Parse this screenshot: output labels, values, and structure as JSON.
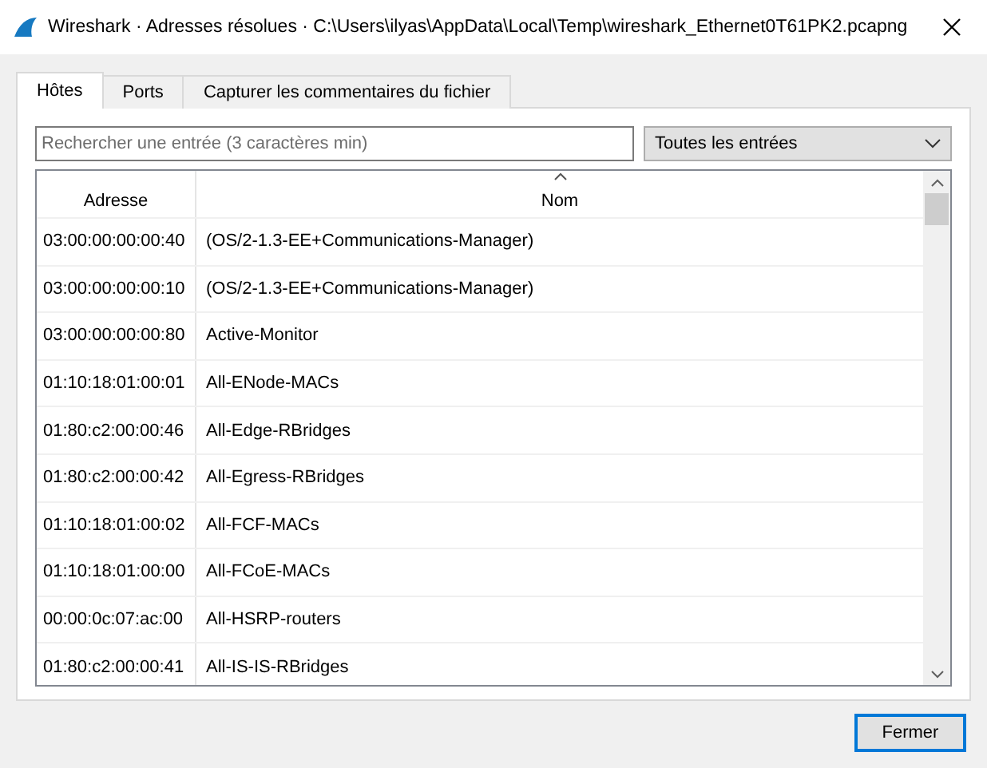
{
  "window": {
    "title": "Wireshark · Adresses résolues · C:\\Users\\ilyas\\AppData\\Local\\Temp\\wireshark_Ethernet0T61PK2.pcapng"
  },
  "tabs": [
    {
      "label": "Hôtes",
      "selected": true
    },
    {
      "label": "Ports",
      "selected": false
    },
    {
      "label": "Capturer les commentaires du fichier",
      "selected": false
    }
  ],
  "search": {
    "placeholder": "Rechercher une entrée (3 caractères min)"
  },
  "filter": {
    "value": "Toutes les entrées"
  },
  "table": {
    "columns": [
      {
        "label": "Adresse",
        "sorted": false
      },
      {
        "label": "Nom",
        "sorted": true
      }
    ],
    "rows": [
      [
        "03:00:00:00:00:40",
        "(OS/2-1.3-EE+Communications-Manager)"
      ],
      [
        "03:00:00:00:00:10",
        "(OS/2-1.3-EE+Communications-Manager)"
      ],
      [
        "03:00:00:00:00:80",
        "Active-Monitor"
      ],
      [
        "01:10:18:01:00:01",
        "All-ENode-MACs"
      ],
      [
        "01:80:c2:00:00:46",
        "All-Edge-RBridges"
      ],
      [
        "01:80:c2:00:00:42",
        "All-Egress-RBridges"
      ],
      [
        "01:10:18:01:00:02",
        "All-FCF-MACs"
      ],
      [
        "01:10:18:01:00:00",
        "All-FCoE-MACs"
      ],
      [
        "00:00:0c:07:ac:00",
        "All-HSRP-routers"
      ],
      [
        "01:80:c2:00:00:41",
        "All-IS-IS-RBridges"
      ]
    ]
  },
  "buttons": [
    {
      "label": "Fermer"
    }
  ]
}
